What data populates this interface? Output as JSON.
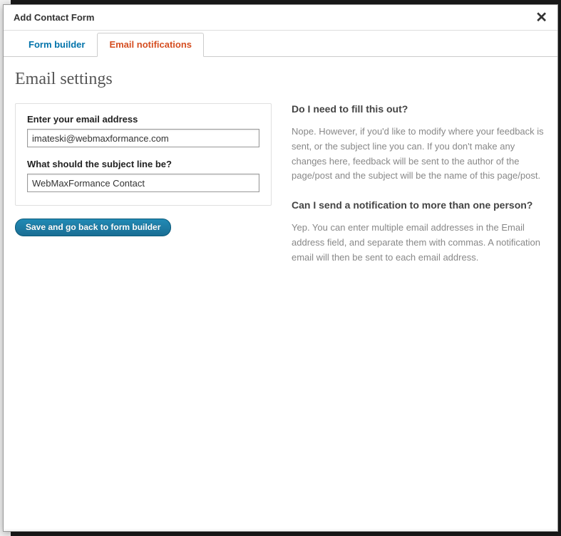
{
  "modal": {
    "title": "Add Contact Form"
  },
  "tabs": {
    "form_builder": "Form builder",
    "email_notifications": "Email notifications"
  },
  "page_heading": "Email settings",
  "form": {
    "email_label": "Enter your email address",
    "email_value": "imateski@webmaxformance.com",
    "subject_label": "What should the subject line be?",
    "subject_value": "WebMaxFormance Contact",
    "save_button": "Save and go back to form builder"
  },
  "help": {
    "q1": "Do I need to fill this out?",
    "a1": "Nope. However, if you'd like to modify where your feedback is sent, or the subject line you can. If you don't make any changes here, feedback will be sent to the author of the page/post and the subject will be the name of this page/post.",
    "q2": "Can I send a notification to more than one person?",
    "a2": "Yep. You can enter multiple email addresses in the Email address field, and separate them with commas. A notification email will then be sent to each email address."
  }
}
